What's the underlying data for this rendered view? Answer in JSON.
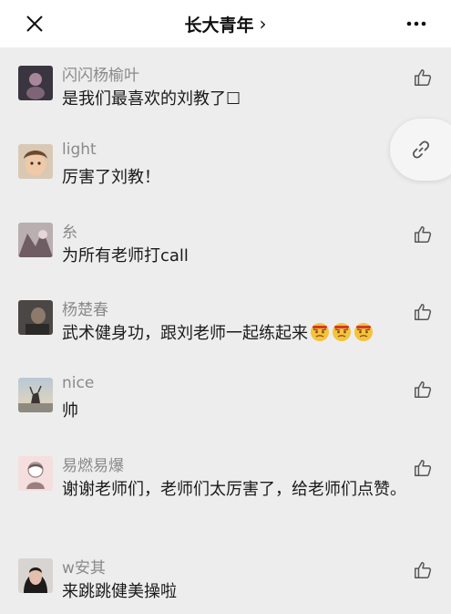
{
  "header": {
    "title": "长大青年",
    "chevron": "›"
  },
  "comments": [
    {
      "user": "闪闪杨榆叶",
      "text": "是我们最喜欢的刘教了☐",
      "liked": false
    },
    {
      "user": "light",
      "text": "厉害了刘教！",
      "liked": false
    },
    {
      "user": "糸",
      "text": "为所有老师打call",
      "liked": false
    },
    {
      "user": "杨楚春",
      "text": "武术健身功，跟刘老师一起练起来",
      "emoji_count": 3,
      "liked": false
    },
    {
      "user": "nice",
      "text": "帅",
      "liked": false
    },
    {
      "user": "易燃易爆",
      "text": "谢谢老师们，老师们太厉害了，给老师们点赞。",
      "liked": false
    },
    {
      "user": "w安其",
      "text": "来跳跳健美操啦",
      "liked": false
    }
  ],
  "colors": {
    "background": "#ededed",
    "username": "#8a8a8a",
    "icon": "#555555"
  },
  "icons": [
    "close-icon",
    "more-icon",
    "like-icon",
    "link-icon",
    "emoji-face-icon"
  ]
}
